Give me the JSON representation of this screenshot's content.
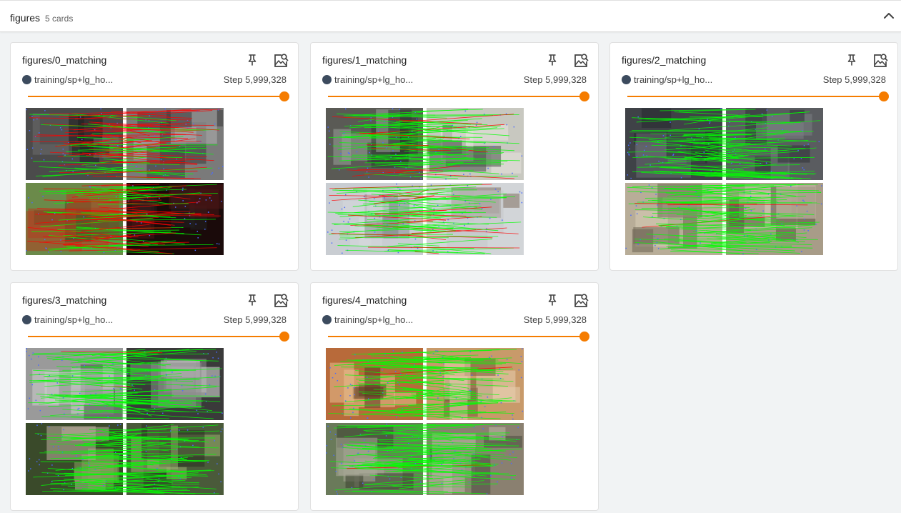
{
  "group": {
    "title": "figures",
    "count": "5 cards",
    "collapse_icon": "chevron-up-icon"
  },
  "cards": [
    {
      "title": "figures/0_matching",
      "run": "training/sp+lg_ho...",
      "step": "Step 5,999,328",
      "run_color": "#3c4b5e",
      "slider_value": 1.0,
      "pin_icon": "pin-icon",
      "zoom_icon": "image-search-icon",
      "image_alt": "feature matching visualization, pair 0"
    },
    {
      "title": "figures/1_matching",
      "run": "training/sp+lg_ho...",
      "step": "Step 5,999,328",
      "run_color": "#3c4b5e",
      "slider_value": 1.0,
      "pin_icon": "pin-icon",
      "zoom_icon": "image-search-icon",
      "image_alt": "feature matching visualization, pair 1"
    },
    {
      "title": "figures/2_matching",
      "run": "training/sp+lg_ho...",
      "step": "Step 5,999,328",
      "run_color": "#3c4b5e",
      "slider_value": 1.0,
      "pin_icon": "pin-icon",
      "zoom_icon": "image-search-icon",
      "image_alt": "feature matching visualization, pair 2"
    },
    {
      "title": "figures/3_matching",
      "run": "training/sp+lg_ho...",
      "step": "Step 5,999,328",
      "run_color": "#3c4b5e",
      "slider_value": 1.0,
      "pin_icon": "pin-icon",
      "zoom_icon": "image-search-icon",
      "image_alt": "feature matching visualization, pair 3"
    },
    {
      "title": "figures/4_matching",
      "run": "training/sp+lg_ho...",
      "step": "Step 5,999,328",
      "run_color": "#3c4b5e",
      "slider_value": 1.0,
      "pin_icon": "pin-icon",
      "zoom_icon": "image-search-icon",
      "image_alt": "feature matching visualization, pair 4"
    }
  ],
  "colors": {
    "accent": "#f57c00",
    "match_good": "#00ff00",
    "match_bad": "#ff0000",
    "keypoint": "#4a6cff"
  }
}
